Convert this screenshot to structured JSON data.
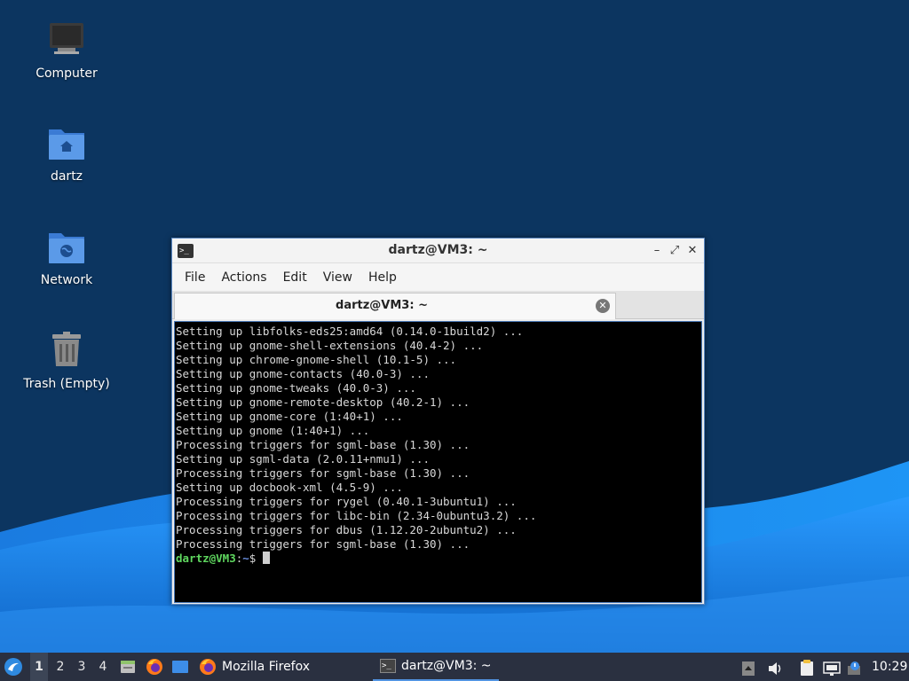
{
  "desktop": {
    "icons": [
      {
        "label": "Computer"
      },
      {
        "label": "dartz"
      },
      {
        "label": "Network"
      },
      {
        "label": "Trash (Empty)"
      }
    ]
  },
  "terminal": {
    "title": "dartz@VM3: ~",
    "menu": [
      "File",
      "Actions",
      "Edit",
      "View",
      "Help"
    ],
    "tab_label": "dartz@VM3: ~",
    "lines": [
      "Setting up libfolks-eds25:amd64 (0.14.0-1build2) ...",
      "Setting up gnome-shell-extensions (40.4-2) ...",
      "Setting up chrome-gnome-shell (10.1-5) ...",
      "Setting up gnome-contacts (40.0-3) ...",
      "Setting up gnome-tweaks (40.0-3) ...",
      "Setting up gnome-remote-desktop (40.2-1) ...",
      "Setting up gnome-core (1:40+1) ...",
      "Setting up gnome (1:40+1) ...",
      "Processing triggers for sgml-base (1.30) ...",
      "Setting up sgml-data (2.0.11+nmu1) ...",
      "Processing triggers for sgml-base (1.30) ...",
      "Setting up docbook-xml (4.5-9) ...",
      "Processing triggers for rygel (0.40.1-3ubuntu1) ...",
      "Processing triggers for libc-bin (2.34-0ubuntu3.2) ...",
      "Processing triggers for dbus (1.12.20-2ubuntu2) ...",
      "Processing triggers for sgml-base (1.30) ..."
    ],
    "prompt": {
      "user": "dartz@VM3",
      "sep": ":",
      "path": "~",
      "symbol": "$ "
    }
  },
  "taskbar": {
    "workspaces": [
      "1",
      "2",
      "3",
      "4"
    ],
    "active_workspace": "1",
    "tasks": [
      {
        "label": "Mozilla Firefox",
        "icon": "firefox-icon"
      },
      {
        "label": "dartz@VM3: ~",
        "icon": "terminal-icon"
      }
    ],
    "clock": "10:29"
  },
  "colors": {
    "desktop_bg": "#0c3560",
    "wave_light": "#1f8df0",
    "taskbar_bg": "#2a3040",
    "accent": "#5294e2"
  }
}
